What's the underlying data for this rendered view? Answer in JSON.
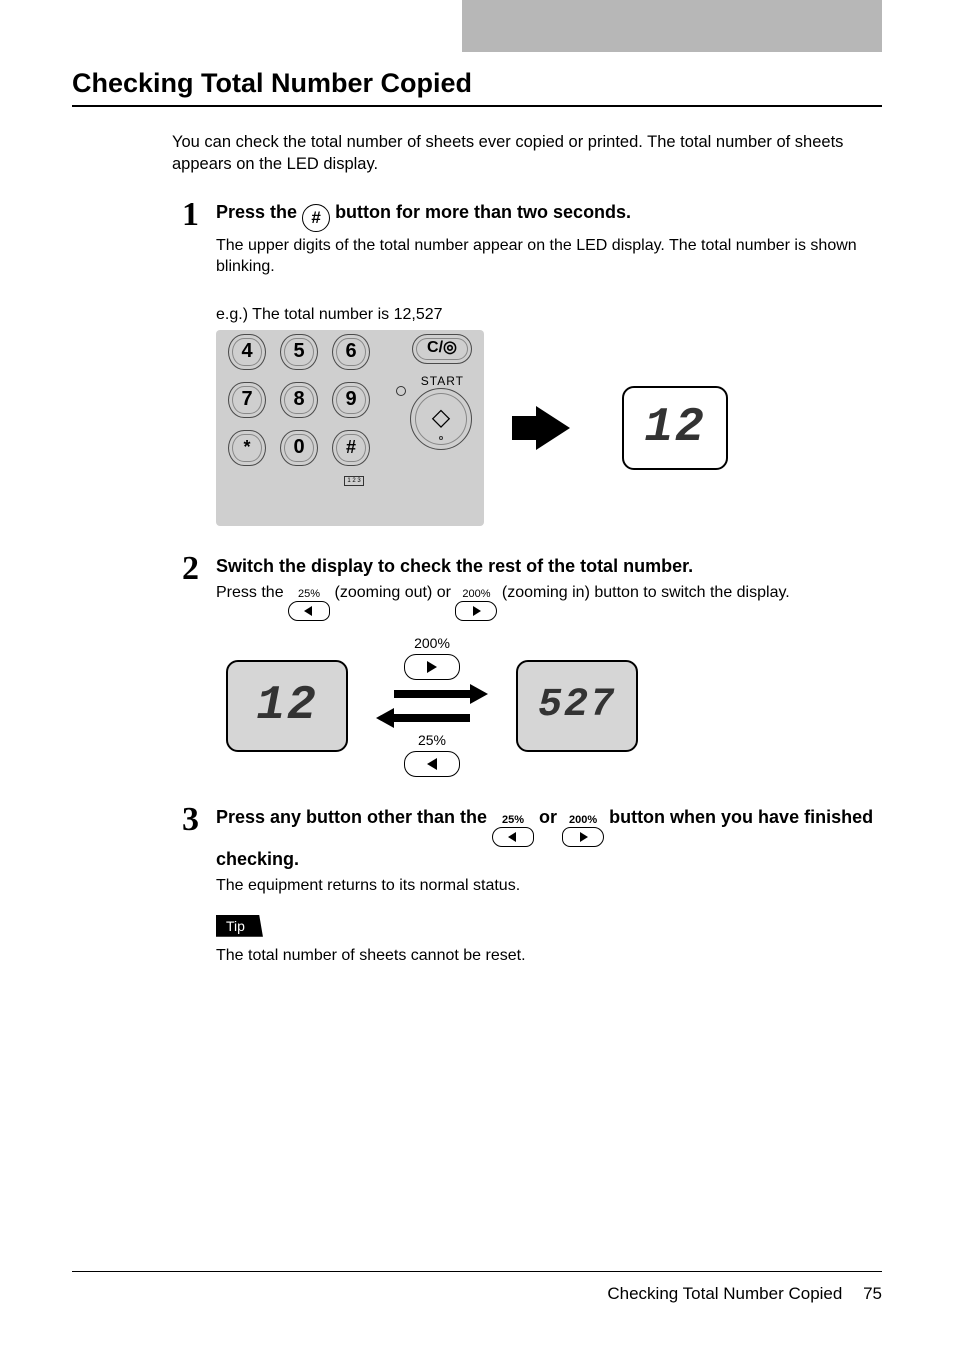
{
  "page": {
    "title": "Checking Total Number Copied",
    "intro": "You can check the total number of sheets ever copied or printed. The total number of sheets appears on the LED display.",
    "footer_title": "Checking Total Number Copied",
    "footer_page": "75"
  },
  "steps": {
    "1": {
      "num": "1",
      "head_pre": "Press the ",
      "hash_symbol": "#",
      "head_post": " button for more than two seconds.",
      "sub": "The upper digits of the total number appear on the LED display. The total number is shown blinking.",
      "eg": "e.g.) The total number is 12,527",
      "panel": {
        "keys": {
          "k4": "4",
          "k5": "5",
          "k6": "6",
          "k7": "7",
          "k8": "8",
          "k9": "9",
          "kst": "*",
          "k0": "0",
          "kha": "#"
        },
        "clear": "C/◎",
        "start": "START",
        "tab123": "1 2 3"
      },
      "led": "12"
    },
    "2": {
      "num": "2",
      "head": "Switch the display to check the rest of the total number.",
      "sub_pre": "Press the ",
      "zoom_out_pct": "25%",
      "sub_mid1": " (zooming out) or ",
      "zoom_in_pct": "200%",
      "sub_mid2": " (zooming in) button to switch the display.",
      "fig": {
        "pct_200": "200%",
        "pct_25": "25%",
        "led_a": "12",
        "led_b": "527"
      }
    },
    "3": {
      "num": "3",
      "head_pre": "Press any button other than the ",
      "zoom_out_pct": "25%",
      "head_mid": " or ",
      "zoom_in_pct": "200%",
      "head_post": " button when you have finished checking.",
      "sub": "The equipment returns to its normal status.",
      "tip_label": "Tip",
      "tip_text": "The total number of sheets cannot be reset."
    }
  }
}
